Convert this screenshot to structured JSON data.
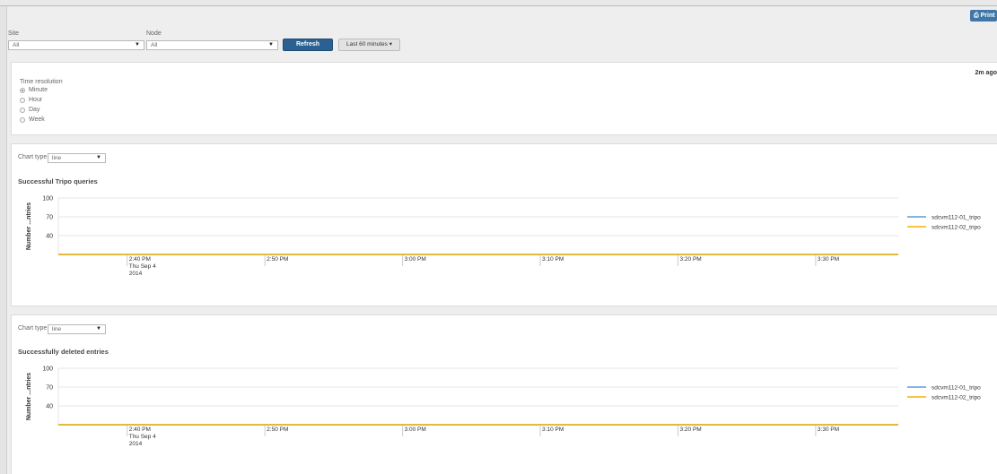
{
  "toolbar": {
    "print_label": "Print",
    "site_label": "Site",
    "site_value": "All",
    "node_label": "Node",
    "node_value": "All",
    "refresh_label": "Refresh",
    "range_label": "Last 60 minutes ▾"
  },
  "resolution": {
    "updated_ago": "2m ago",
    "title": "Time resolution",
    "options": [
      "Minute",
      "Hour",
      "Day",
      "Week"
    ],
    "selected": "Minute"
  },
  "charts": [
    {
      "chart_type_label": "Chart type",
      "chart_type_value": "line"
    },
    {
      "chart_type_label": "Chart type",
      "chart_type_value": "line"
    }
  ],
  "chart_data": [
    {
      "type": "line",
      "title": "Successful Tripo queries",
      "ylabel": "Number ...ntries",
      "yticks": [
        100,
        70,
        40
      ],
      "ylim": [
        10,
        100
      ],
      "x_ticks": [
        "2:40 PM",
        "2:50 PM",
        "3:00 PM",
        "3:10 PM",
        "3:20 PM",
        "3:30 PM"
      ],
      "x_tick_sub": [
        "Thu Sep 4",
        "2014"
      ],
      "x": [
        "2:35 PM",
        "3:36 PM"
      ],
      "series": [
        {
          "name": "sdcvm112-01_tripo",
          "color": "#5b9bd5",
          "values": [
            10,
            10
          ]
        },
        {
          "name": "sdcvm112-02_tripo",
          "color": "#f5b400",
          "values": [
            10,
            10
          ]
        }
      ],
      "legend": "right"
    },
    {
      "type": "line",
      "title": "Successfully deleted entries",
      "ylabel": "Number ...ntries",
      "yticks": [
        100,
        70,
        40
      ],
      "ylim": [
        10,
        100
      ],
      "x_ticks": [
        "2:40 PM",
        "2:50 PM",
        "3:00 PM",
        "3:10 PM",
        "3:20 PM",
        "3:30 PM"
      ],
      "x_tick_sub": [
        "Thu Sep 4",
        "2014"
      ],
      "x": [
        "2:35 PM",
        "3:36 PM"
      ],
      "series": [
        {
          "name": "sdcvm112-01_tripo",
          "color": "#5b9bd5",
          "values": [
            10,
            10
          ]
        },
        {
          "name": "sdcvm112-02_tripo",
          "color": "#f5b400",
          "values": [
            10,
            10
          ]
        }
      ],
      "legend": "right"
    }
  ]
}
